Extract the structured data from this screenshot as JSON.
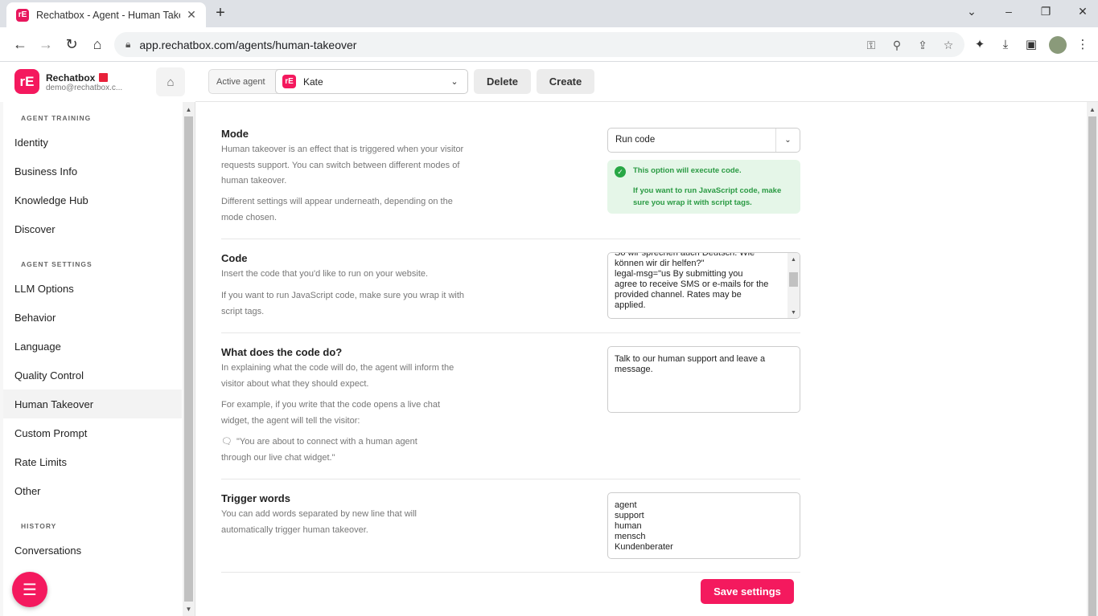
{
  "browser": {
    "tab_title": "Rechatbox - Agent - Human Takeover",
    "url": "app.rechatbox.com/agents/human-takeover"
  },
  "brand": {
    "name": "Rechatbox",
    "email": "demo@rechatbox.c...",
    "logo_text": "rE"
  },
  "topbar": {
    "active_agent_label": "Active agent",
    "agent_name": "Kate",
    "delete_label": "Delete",
    "create_label": "Create"
  },
  "sidebar": {
    "sections": [
      {
        "title": "AGENT TRAINING",
        "items": [
          "Identity",
          "Business Info",
          "Knowledge Hub",
          "Discover"
        ]
      },
      {
        "title": "AGENT SETTINGS",
        "items": [
          "LLM Options",
          "Behavior",
          "Language",
          "Quality Control",
          "Human Takeover",
          "Custom Prompt",
          "Rate Limits",
          "Other"
        ]
      },
      {
        "title": "HISTORY",
        "items": [
          "Conversations"
        ]
      }
    ],
    "active_item": "Human Takeover"
  },
  "mode": {
    "title": "Mode",
    "desc1": "Human takeover is an effect that is triggered when your visitor requests support. You can switch between different modes of human takeover.",
    "desc2": "Different settings will appear underneath, depending on the mode chosen.",
    "selected": "Run code",
    "success_title": "This option will execute code.",
    "success_text": "If you want to run JavaScript code, make sure you wrap it with script tags."
  },
  "code": {
    "title": "Code",
    "desc1": "Insert the code that you'd like to run on your website.",
    "desc2": "If you want to run JavaScript code, make sure you wrap it with script tags.",
    "value": "So wir sprechen auch Deutsch. Wie\nkönnen wir dir helfen?\"\n  legal-msg=\"us By submitting you\nagree to receive SMS or e-mails for the\nprovided channel. Rates may be\napplied."
  },
  "what": {
    "title": "What does the code do?",
    "desc1": "In explaining what the code will do, the agent will inform the visitor about what they should expect.",
    "desc2": "For example, if you write that the code opens a live chat widget, the agent will tell the visitor:",
    "quote": "\"You are about to connect with a human agent through our live chat widget.\"",
    "value": "Talk to our human support and leave a message."
  },
  "trigger": {
    "title": "Trigger words",
    "desc": "You can add words separated by new line that will automatically trigger human takeover.",
    "value": "agent\nsupport\nhuman\nmensch\nKundenberater"
  },
  "save_label": "Save settings",
  "colors": {
    "brand": "#f4195e",
    "success_bg": "#e5f6e8",
    "success_text": "#2a9a43"
  }
}
